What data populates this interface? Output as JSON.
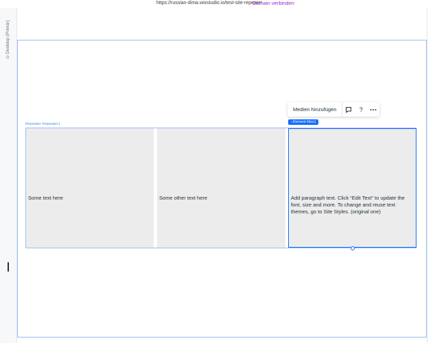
{
  "topbar": {
    "url": "https://russian-dima.wixstudio.io/test-site-repeater",
    "domain_link": "Domain verbinden"
  },
  "gutter": {
    "label": "Desktop (Primär)"
  },
  "toolbar": {
    "main_action": "Medien hinzufügen",
    "icons": [
      "comment-icon",
      "help-icon",
      "more-icon"
    ]
  },
  "breadcrumb": {
    "label": "‹ Element #box1"
  },
  "repeater": {
    "label": "Repeater #repeater1",
    "items": [
      {
        "text": "Some text here"
      },
      {
        "text": "Some other text here"
      },
      {
        "text": "Add paragraph text. Click “Edit Text” to update the font, size and more. To change and reuse text themes, go to Site Styles. (original one)"
      }
    ]
  },
  "colors": {
    "selection": "#116dff",
    "frame": "#9bbcf1",
    "item_bg": "#ececec",
    "link": "#9a27d5"
  }
}
